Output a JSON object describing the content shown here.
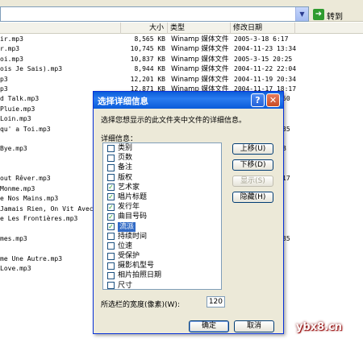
{
  "address_bar": {
    "go_label": "转到"
  },
  "columns": {
    "size": "大小",
    "type": "类型",
    "date": "修改日期"
  },
  "files": [
    {
      "name": "ir.mp3",
      "size": "8,565 KB",
      "type": "Winamp 媒体文件",
      "date": "2005-3-18 6:17",
      "right": ""
    },
    {
      "name": "r.mp3",
      "size": "10,745 KB",
      "type": "Winamp 媒体文件",
      "date": "2004-11-23 13:34",
      "right": ""
    },
    {
      "name": "oi.mp3",
      "size": "10,837 KB",
      "type": "Winamp 媒体文件",
      "date": "2005-3-15 20:25",
      "right": ""
    },
    {
      "name": "ois Je Sais).mp3",
      "size": "8,944 KB",
      "type": "Winamp 媒体文件",
      "date": "2004-11-22 22:04",
      "right": ""
    },
    {
      "name": "p3",
      "size": "12,201 KB",
      "type": "Winamp 媒体文件",
      "date": "2004-11-19 20:34",
      "right": ""
    },
    {
      "name": "p3",
      "size": "12,871 KB",
      "type": "Winamp 媒体文件",
      "date": "2004-11-17 18:17",
      "right": ""
    },
    {
      "name": "d Talk.mp3",
      "size": "",
      "type": "",
      "date": "",
      "right": "50"
    },
    {
      "name": " Pluie.mp3",
      "size": "",
      "type": "",
      "date": "",
      "right": ""
    },
    {
      "name": " Loin.mp3",
      "size": "",
      "type": "",
      "date": "",
      "right": ""
    },
    {
      "name": "qu' a Toi.mp3",
      "size": "",
      "type": "",
      "date": "",
      "right": "35"
    },
    {
      "name": "",
      "size": "",
      "type": "",
      "date": "",
      "right": ""
    },
    {
      "name": " Bye.mp3",
      "size": "",
      "type": "",
      "date": "",
      "right": "8"
    },
    {
      "name": "",
      "size": "",
      "type": "",
      "date": "",
      "right": ""
    },
    {
      "name": "",
      "size": "",
      "type": "",
      "date": "",
      "right": ""
    },
    {
      "name": "out Rêver.mp3",
      "size": "",
      "type": "",
      "date": "",
      "right": "17"
    },
    {
      "name": " Monme.mp3",
      "size": "",
      "type": "",
      "date": "",
      "right": ""
    },
    {
      "name": "e Nos Mains.mp3",
      "size": "",
      "type": "",
      "date": "",
      "right": ""
    },
    {
      "name": "Jamais Rien, On Vit Avec ( En",
      "size": "",
      "type": "",
      "date": "",
      "right": ""
    },
    {
      "name": "e Les Frontières.mp3",
      "size": "",
      "type": "",
      "date": "",
      "right": ""
    },
    {
      "name": "",
      "size": "",
      "type": "",
      "date": "",
      "right": ""
    },
    {
      "name": "mes.mp3",
      "size": "",
      "type": "",
      "date": "",
      "right": "35"
    },
    {
      "name": "",
      "size": "",
      "type": "",
      "date": "",
      "right": ""
    },
    {
      "name": "me Une Autre.mp3",
      "size": "",
      "type": "",
      "date": "",
      "right": ""
    },
    {
      "name": " Love.mp3",
      "size": "",
      "type": "",
      "date": "",
      "right": ""
    }
  ],
  "dialog": {
    "title": "选择详细信息",
    "help_glyph": "?",
    "close_glyph": "✕",
    "description": "选择您想显示的此文件夹中文件的详细信息。",
    "list_label": "详细信息：",
    "items": [
      {
        "label": "类别",
        "checked": false,
        "selected": false
      },
      {
        "label": "页数",
        "checked": false,
        "selected": false
      },
      {
        "label": "备注",
        "checked": false,
        "selected": false
      },
      {
        "label": "版权",
        "checked": false,
        "selected": false
      },
      {
        "label": "艺术家",
        "checked": true,
        "selected": false
      },
      {
        "label": "唱片标题",
        "checked": true,
        "selected": false
      },
      {
        "label": "发行年",
        "checked": true,
        "selected": false
      },
      {
        "label": "曲目号码",
        "checked": true,
        "selected": false
      },
      {
        "label": "流派",
        "checked": true,
        "selected": true
      },
      {
        "label": "持续时间",
        "checked": false,
        "selected": false
      },
      {
        "label": "位速",
        "checked": false,
        "selected": false
      },
      {
        "label": "受保护",
        "checked": false,
        "selected": false
      },
      {
        "label": "摄影机型号",
        "checked": false,
        "selected": false
      },
      {
        "label": "相片拍照日期",
        "checked": false,
        "selected": false
      },
      {
        "label": "尺寸",
        "checked": false,
        "selected": false
      }
    ],
    "buttons": {
      "move_up": "上移(U)",
      "move_down": "下移(D)",
      "show": "显示(S)",
      "hide": "隐藏(H)"
    },
    "width_label": "所选栏的宽度(像素)(W):",
    "width_value": "120",
    "ok": "确定",
    "cancel": "取消"
  },
  "watermark": "ybx8.cn"
}
